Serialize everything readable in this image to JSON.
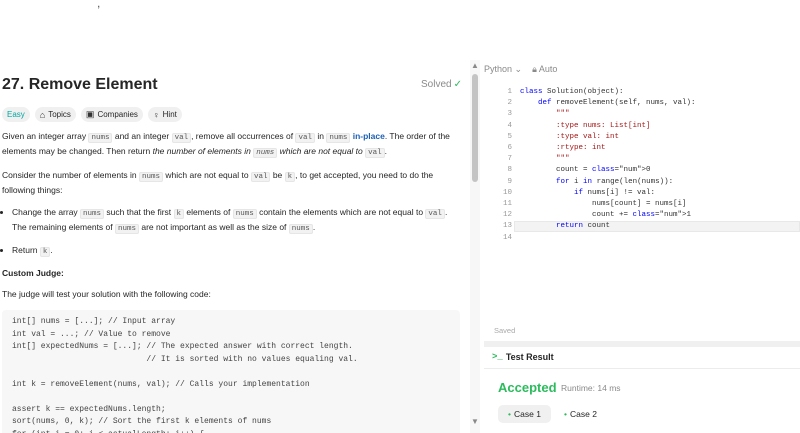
{
  "topbar": {
    "clipped_text": ","
  },
  "problem": {
    "title": "27. Remove Element",
    "status": "Solved",
    "tags": [
      "Easy",
      "Topics",
      "Companies",
      "Hint"
    ],
    "desc1_a": "Given an integer array ",
    "code_nums": "nums",
    "desc1_b": " and an integer ",
    "code_val": "val",
    "desc1_c": ", remove all occurrences of ",
    "desc1_d": " in ",
    "desc1_e": "in-place",
    "desc1_f": ". The order of the elements may be changed. Then return ",
    "desc1_g": "the number of elements in ",
    "desc1_h": " which are not equal to ",
    "desc1_i": ".",
    "desc2_a": "Consider the number of elements in ",
    "desc2_b": " which are not equal to ",
    "desc2_c": " be ",
    "code_k": "k",
    "desc2_d": ", to get accepted, you need to do the following things:",
    "bullet1_a": "Change the array ",
    "bullet1_b": " such that the first ",
    "bullet1_c": " elements of ",
    "bullet1_d": " contain the elements which are not equal to ",
    "bullet1_e": ". The remaining elements of ",
    "bullet1_f": " are not important as well as the size of ",
    "bullet1_g": ".",
    "bullet2_a": "Return ",
    "bullet2_b": ".",
    "judge_heading": "Custom Judge:",
    "judge_text": "The judge will test your solution with the following code:",
    "judge_code": "int[] nums = [...]; // Input array\nint val = ...; // Value to remove\nint[] expectedNums = [...]; // The expected answer with correct length.\n                            // It is sorted with no values equaling val.\n\nint k = removeElement(nums, val); // Calls your implementation\n\nassert k == expectedNums.length;\nsort(nums, 0, k); // Sort the first k elements of nums\nfor (int i = 0; i < actualLength; i++) {"
  },
  "editor": {
    "language": "Python",
    "mode": "Auto",
    "saved_label": "Saved",
    "lines": [
      {
        "n": "1",
        "t": "class Solution(object):"
      },
      {
        "n": "2",
        "t": "    def removeElement(self, nums, val):"
      },
      {
        "n": "3",
        "t": "        \"\"\""
      },
      {
        "n": "4",
        "t": "        :type nums: List[int]"
      },
      {
        "n": "5",
        "t": "        :type val: int"
      },
      {
        "n": "6",
        "t": "        :rtype: int"
      },
      {
        "n": "7",
        "t": "        \"\"\""
      },
      {
        "n": "8",
        "t": "        count = 0"
      },
      {
        "n": "9",
        "t": "        for i in range(len(nums)):"
      },
      {
        "n": "10",
        "t": "            if nums[i] != val:"
      },
      {
        "n": "11",
        "t": "                nums[count] = nums[i]"
      },
      {
        "n": "12",
        "t": "                count += 1"
      },
      {
        "n": "13",
        "t": "        return count"
      },
      {
        "n": "14",
        "t": ""
      }
    ]
  },
  "result": {
    "heading": "Test Result",
    "status": "Accepted",
    "runtime": "Runtime: 14 ms",
    "cases": [
      "Case 1",
      "Case 2"
    ]
  },
  "colors": {
    "accepted": "#2cbb5d",
    "easy": "#00a7a2",
    "keyword": "#0000ff"
  }
}
